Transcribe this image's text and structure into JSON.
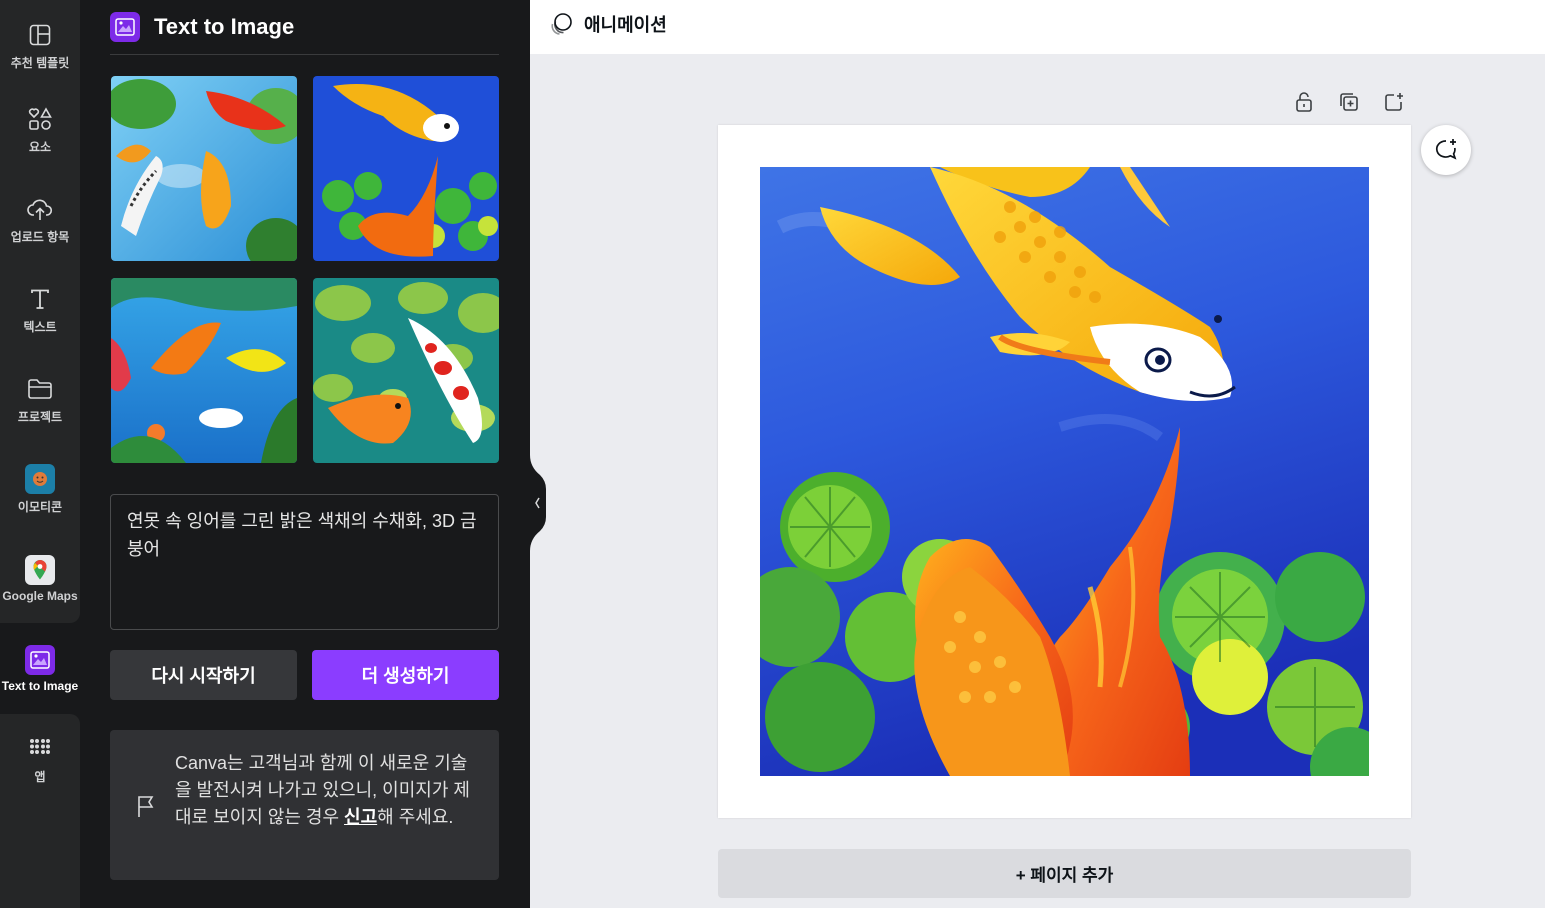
{
  "rail": {
    "items": [
      {
        "label": "추천 템플릿",
        "icon": "template-icon"
      },
      {
        "label": "요소",
        "icon": "elements-icon"
      },
      {
        "label": "업로드 항목",
        "icon": "upload-cloud-icon"
      },
      {
        "label": "텍스트",
        "icon": "text-icon"
      },
      {
        "label": "프로젝트",
        "icon": "folder-icon"
      },
      {
        "label": "이모티콘",
        "icon": "emoji-app-icon"
      },
      {
        "label": "Google Maps",
        "icon": "google-maps-icon"
      },
      {
        "label": "Text to Image",
        "icon": "text-to-image-icon"
      },
      {
        "label": "앱",
        "icon": "apps-grid-icon"
      }
    ]
  },
  "panel": {
    "title": "Text to Image",
    "prompt": "연못 속 잉어를 그린 밝은 색채의 수채화, 3D 금붕어",
    "restart_label": "다시 시작하기",
    "generate_label": "더 생성하기",
    "notice_text": "Canva는 고객님과 함께 이 새로운 기술을 발전시켜 나가고 있으니, 이미지가 제대로 보이지 않는 경우 ",
    "notice_link": "신고",
    "notice_suffix": "해 주세요."
  },
  "topbar": {
    "animation_label": "애니메이션"
  },
  "canvas": {
    "add_page_label": "+ 페이지 추가"
  },
  "colors": {
    "accent": "#8b3dff",
    "panel_bg": "#18191b",
    "rail_bg": "#252627",
    "canvas_bg": "#ebecf0"
  }
}
